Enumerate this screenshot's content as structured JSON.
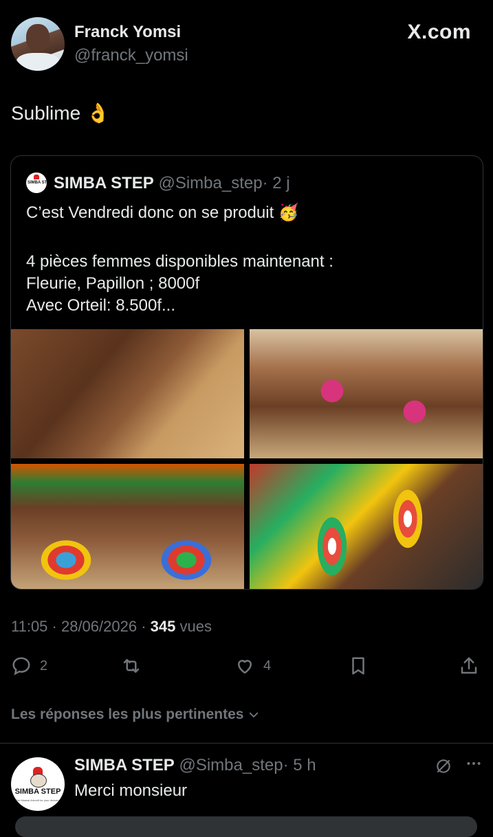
{
  "post": {
    "author_name": "Franck Yomsi",
    "author_handle": "@franck_yomsi",
    "brand": "X.com",
    "text": "Sublime 👌"
  },
  "quote": {
    "author_name": "SIMBA STEP",
    "author_handle": "@Simba_step",
    "time": "· 2 j",
    "logo_text": "SIMBA STEP",
    "line1": "C’est Vendredi donc on se produit 🥳",
    "line2": "4 pièces femmes disponibles maintenant :",
    "line3": "Fleurie, Papillon ; 8000f",
    "line4": "Avec Orteil: 8.500f..."
  },
  "meta": {
    "timestamp": "11:05 · 28/06/2026 · ",
    "views_count": "345",
    "views_label": " vues"
  },
  "actions": {
    "replies": "2",
    "likes": "4"
  },
  "replies_sort_label": "Les réponses les plus pertinentes",
  "reply": {
    "author_name": "SIMBA STEP",
    "author_handle": "@Simba_step",
    "time": "· 5 h",
    "text": "Merci monsieur",
    "avatar_text": "SIMBA STEP",
    "avatar_subtext": "The Maasai Artcraft for your dressing"
  },
  "icons": {
    "reply": "reply-icon",
    "retweet": "retweet-icon",
    "like": "heart-icon",
    "bookmark": "bookmark-icon",
    "share": "share-icon",
    "grok": "grok-icon",
    "more": "more-icon"
  }
}
